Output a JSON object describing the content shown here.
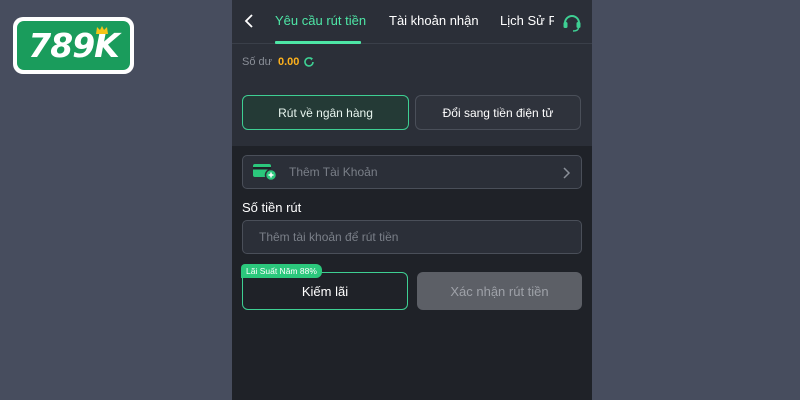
{
  "logo": {
    "text": "789K"
  },
  "tabs": [
    {
      "label": "Yêu cầu rút tiền"
    },
    {
      "label": "Tài khoản nhận"
    },
    {
      "label": "Lịch Sử R"
    }
  ],
  "balance": {
    "label": "Số dư",
    "value": "0.00"
  },
  "methods": {
    "bank": "Rút về ngân hàng",
    "ewallet": "Đổi sang tiền điện tử"
  },
  "add_account": {
    "label": "Thêm Tài Khoản"
  },
  "amount": {
    "label": "Số tiền rút",
    "placeholder": "Thêm tài khoản để rút tiền"
  },
  "earn": {
    "label": "Kiếm lãi",
    "badge": "Lãi Suất Năm 88%"
  },
  "confirm": {
    "label": "Xác nhận rút tiền"
  },
  "colors": {
    "accent": "#4ee6a6",
    "balance": "#ffb21c",
    "badge": "#2bc87c",
    "logo_bg": "#1a9c5c"
  }
}
